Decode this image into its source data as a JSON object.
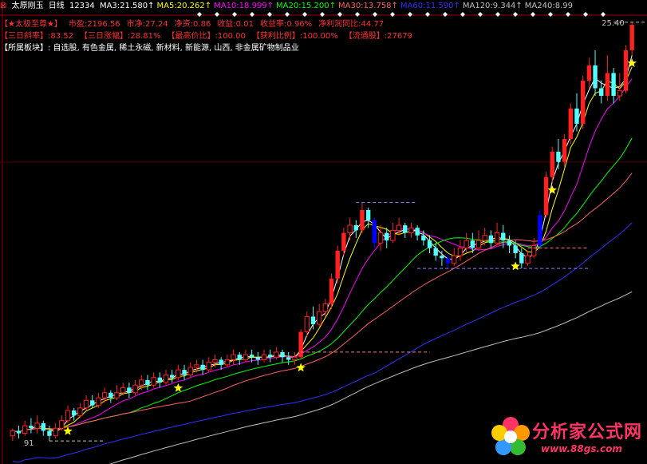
{
  "header": {
    "title": "太原刚玉",
    "period": "日线",
    "code": "12334",
    "ma": [
      {
        "label": "MA3:",
        "value": "21.580",
        "arrow": "↑",
        "color": "#ffffff"
      },
      {
        "label": "MA5:",
        "value": "20.262",
        "arrow": "↑",
        "color": "#ffff00"
      },
      {
        "label": "MA10:",
        "value": "18.999",
        "arrow": "↑",
        "color": "#ff00ff"
      },
      {
        "label": "MA20:",
        "value": "15.200",
        "arrow": "↑",
        "color": "#00ff00"
      },
      {
        "label": "MA30:",
        "value": "13.758",
        "arrow": "↑",
        "color": "#ff6060"
      },
      {
        "label": "MA60:",
        "value": "11.590",
        "arrow": "↑",
        "color": "#3030ff"
      },
      {
        "label": "MA120:",
        "value": "9.344",
        "arrow": "↑",
        "color": "#c0c0c0"
      },
      {
        "label": "MA240:",
        "value": "8.99",
        "arrow": "",
        "color": "#c0c0c0"
      }
    ]
  },
  "info": {
    "line1": [
      {
        "k": "【★太极至尊★】",
        "v": ""
      },
      {
        "k": "市盈",
        "v": ":2196.56"
      },
      {
        "k": "市净",
        "v": ":27.24"
      },
      {
        "k": "净资",
        "v": ":0.86"
      },
      {
        "k": "收益",
        "v": ":0.01"
      },
      {
        "k": "收益率",
        "v": ":0.96%"
      },
      {
        "k": "净利润同比",
        "v": ":44.77"
      }
    ],
    "line2": [
      {
        "k": "【三日斜率】",
        "v": ":83.52"
      },
      {
        "k": "【三日涨幅】",
        "v": ":28.81%"
      },
      {
        "k": "【最高价比】",
        "v": ":100.00"
      },
      {
        "k": "【获利比例】",
        "v": ":100.00%"
      },
      {
        "k": "【流通股】",
        "v": ":27679"
      }
    ],
    "sector_label": "【所属板块】",
    "sector_value": ": 自选股, 有色金属, 稀土永磁, 新材料, 新能源, 山西, 非金属矿物制品业"
  },
  "chart_data": {
    "type": "candlestick",
    "ylim": [
      8.5,
      26.0
    ],
    "low_marker_label": "91",
    "high_marker_label": "25.40",
    "candles": [
      [
        9.2,
        9.4,
        9.0,
        9.5
      ],
      [
        9.4,
        9.3,
        9.1,
        9.6
      ],
      [
        9.3,
        9.6,
        9.2,
        9.8
      ],
      [
        9.6,
        9.5,
        9.3,
        9.9
      ],
      [
        9.5,
        9.7,
        9.3,
        10.0
      ],
      [
        9.7,
        9.4,
        9.2,
        9.8
      ],
      [
        9.4,
        9.2,
        9.0,
        9.6
      ],
      [
        9.2,
        9.5,
        9.1,
        9.7
      ],
      [
        9.5,
        9.8,
        9.4,
        10.0
      ],
      [
        9.8,
        10.2,
        9.7,
        10.4
      ],
      [
        10.2,
        10.0,
        9.8,
        10.3
      ],
      [
        10.0,
        10.3,
        9.9,
        10.5
      ],
      [
        10.3,
        10.6,
        10.2,
        10.8
      ],
      [
        10.6,
        10.4,
        10.3,
        10.8
      ],
      [
        10.4,
        10.7,
        10.3,
        10.9
      ],
      [
        10.7,
        10.9,
        10.5,
        11.1
      ],
      [
        10.9,
        10.7,
        10.5,
        11.0
      ],
      [
        10.7,
        10.9,
        10.6,
        11.2
      ],
      [
        10.9,
        11.1,
        10.8,
        11.3
      ],
      [
        11.1,
        10.9,
        10.7,
        11.3
      ],
      [
        10.9,
        11.2,
        10.8,
        11.4
      ],
      [
        11.2,
        11.4,
        11.0,
        11.6
      ],
      [
        11.4,
        11.2,
        11.0,
        11.6
      ],
      [
        11.2,
        11.5,
        11.1,
        11.7
      ],
      [
        11.5,
        11.3,
        11.1,
        11.7
      ],
      [
        11.3,
        11.6,
        11.2,
        11.8
      ],
      [
        11.6,
        11.5,
        11.3,
        11.8
      ],
      [
        11.5,
        11.8,
        11.4,
        12.0
      ],
      [
        11.8,
        11.6,
        11.4,
        12.0
      ],
      [
        11.6,
        11.9,
        11.5,
        12.1
      ],
      [
        11.9,
        12.0,
        11.7,
        12.2
      ],
      [
        12.0,
        11.8,
        11.6,
        12.2
      ],
      [
        11.8,
        12.1,
        11.7,
        12.3
      ],
      [
        12.1,
        12.2,
        11.9,
        12.4
      ],
      [
        12.2,
        12.0,
        11.8,
        12.3
      ],
      [
        12.0,
        12.2,
        11.9,
        12.4
      ],
      [
        12.2,
        12.4,
        12.0,
        12.6
      ],
      [
        12.4,
        12.2,
        12.0,
        12.5
      ],
      [
        12.2,
        12.4,
        12.1,
        12.6
      ],
      [
        12.4,
        12.3,
        12.1,
        12.6
      ],
      [
        12.3,
        12.2,
        12.0,
        12.5
      ],
      [
        12.2,
        12.4,
        12.1,
        12.6
      ],
      [
        12.4,
        12.3,
        12.1,
        12.6
      ],
      [
        12.3,
        12.5,
        12.2,
        12.7
      ],
      [
        12.5,
        12.3,
        12.1,
        12.6
      ],
      [
        12.3,
        12.2,
        12.0,
        12.5
      ],
      [
        12.2,
        12.3,
        12.0,
        12.5
      ],
      [
        12.3,
        13.3,
        12.2,
        13.4
      ],
      [
        13.3,
        13.9,
        13.1,
        14.1
      ],
      [
        13.9,
        13.6,
        13.4,
        14.3
      ],
      [
        13.6,
        14.1,
        13.5,
        14.4
      ],
      [
        14.1,
        14.4,
        13.9,
        14.6
      ],
      [
        14.4,
        15.4,
        14.2,
        15.6
      ],
      [
        15.4,
        16.5,
        15.2,
        16.7
      ],
      [
        16.5,
        17.2,
        16.3,
        17.4
      ],
      [
        17.2,
        17.5,
        16.9,
        17.8
      ],
      [
        17.5,
        17.3,
        17.0,
        17.7
      ],
      [
        17.3,
        18.1,
        17.2,
        18.4
      ],
      [
        18.1,
        17.7,
        17.4,
        18.2
      ],
      [
        17.7,
        16.8,
        16.6,
        17.8
      ],
      [
        16.8,
        17.2,
        16.5,
        17.5
      ],
      [
        17.2,
        16.9,
        16.6,
        17.4
      ],
      [
        16.9,
        17.3,
        16.8,
        17.6
      ],
      [
        17.3,
        17.5,
        17.1,
        17.8
      ],
      [
        17.5,
        17.2,
        17.0,
        17.6
      ],
      [
        17.2,
        17.4,
        17.0,
        17.6
      ],
      [
        17.4,
        17.1,
        16.9,
        17.5
      ],
      [
        17.1,
        16.9,
        16.7,
        17.3
      ],
      [
        16.9,
        16.6,
        16.4,
        17.1
      ],
      [
        16.6,
        16.3,
        16.1,
        16.8
      ],
      [
        16.3,
        16.2,
        15.9,
        16.5
      ],
      [
        16.2,
        16.0,
        15.8,
        16.4
      ],
      [
        16.0,
        16.3,
        15.9,
        16.6
      ],
      [
        16.3,
        16.6,
        16.1,
        16.9
      ],
      [
        16.6,
        16.9,
        16.4,
        17.2
      ],
      [
        16.9,
        16.6,
        16.4,
        17.2
      ],
      [
        16.6,
        16.9,
        16.5,
        17.3
      ],
      [
        16.9,
        17.1,
        16.7,
        17.4
      ],
      [
        17.1,
        16.8,
        16.6,
        17.3
      ],
      [
        16.8,
        17.2,
        16.7,
        17.6
      ],
      [
        17.2,
        16.9,
        16.6,
        17.5
      ],
      [
        16.9,
        16.7,
        16.4,
        17.1
      ],
      [
        16.7,
        16.4,
        16.2,
        16.9
      ],
      [
        16.4,
        16.0,
        15.8,
        16.6
      ],
      [
        16.0,
        16.3,
        15.9,
        16.5
      ],
      [
        16.3,
        16.7,
        16.2,
        17.0
      ],
      [
        16.7,
        17.9,
        16.6,
        18.1
      ],
      [
        17.9,
        19.4,
        17.8,
        19.6
      ],
      [
        19.4,
        20.4,
        19.2,
        20.6
      ],
      [
        20.4,
        20.0,
        19.7,
        20.9
      ],
      [
        20.0,
        20.9,
        19.8,
        21.1
      ],
      [
        20.9,
        22.1,
        20.7,
        22.3
      ],
      [
        22.1,
        21.5,
        21.2,
        22.7
      ],
      [
        21.5,
        23.2,
        21.3,
        23.4
      ],
      [
        23.2,
        23.8,
        22.9,
        24.1
      ],
      [
        23.8,
        22.9,
        22.6,
        24.4
      ],
      [
        22.9,
        22.6,
        22.3,
        23.2
      ],
      [
        22.6,
        23.5,
        22.4,
        24.2
      ],
      [
        23.5,
        22.6,
        22.3,
        23.7
      ],
      [
        22.6,
        22.8,
        22.4,
        23.5
      ],
      [
        22.8,
        24.4,
        22.7,
        24.6
      ],
      [
        24.4,
        25.4,
        24.2,
        25.5
      ]
    ],
    "ma": [
      {
        "name": "MA3",
        "color": "#ffffff",
        "period": 3
      },
      {
        "name": "MA5",
        "color": "#ffff00",
        "period": 5
      },
      {
        "name": "MA10",
        "color": "#ff00ff",
        "period": 10
      },
      {
        "name": "MA20",
        "color": "#00ff00",
        "period": 20
      },
      {
        "name": "MA30",
        "color": "#ff6060",
        "period": 30
      },
      {
        "name": "MA60",
        "color": "#3030ff",
        "period": 60
      },
      {
        "name": "MA120",
        "color": "#c0c0c0",
        "period": 120
      }
    ],
    "stars": [
      9,
      27,
      47,
      82,
      88,
      101
    ],
    "blue_candles": [
      59,
      71,
      86
    ]
  },
  "watermark": {
    "name": "分析家公式网",
    "url": "www.88gs.com"
  }
}
